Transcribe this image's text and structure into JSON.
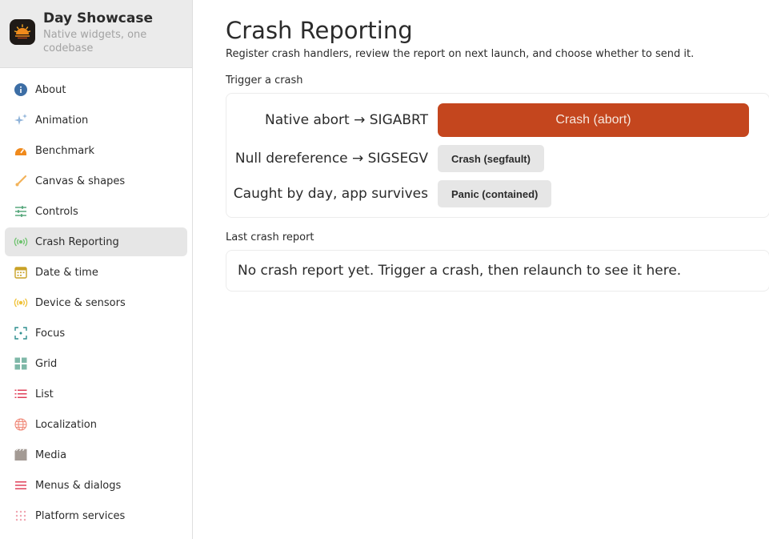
{
  "brand": {
    "title": "Day Showcase",
    "subtitle": "Native widgets, one codebase"
  },
  "sidebar": {
    "items": [
      {
        "label": "About",
        "icon": "info-icon"
      },
      {
        "label": "Animation",
        "icon": "sparkle-icon"
      },
      {
        "label": "Benchmark",
        "icon": "speedometer-icon"
      },
      {
        "label": "Canvas & shapes",
        "icon": "brush-icon"
      },
      {
        "label": "Controls",
        "icon": "sliders-icon"
      },
      {
        "label": "Crash Reporting",
        "icon": "broadcast-icon",
        "active": true
      },
      {
        "label": "Date & time",
        "icon": "calendar-icon"
      },
      {
        "label": "Device & sensors",
        "icon": "sensor-icon"
      },
      {
        "label": "Focus",
        "icon": "focus-icon"
      },
      {
        "label": "Grid",
        "icon": "grid-icon"
      },
      {
        "label": "List",
        "icon": "list-icon"
      },
      {
        "label": "Localization",
        "icon": "globe-icon"
      },
      {
        "label": "Media",
        "icon": "film-icon"
      },
      {
        "label": "Menus & dialogs",
        "icon": "menu-icon"
      },
      {
        "label": "Platform services",
        "icon": "dots-grid-icon"
      }
    ]
  },
  "main": {
    "title": "Crash Reporting",
    "description": "Register crash handlers, review the report on next launch, and choose whether to send it.",
    "trigger_section_label": "Trigger a crash",
    "triggers": [
      {
        "label": "Native abort → SIGABRT",
        "button": "Crash (abort)"
      },
      {
        "label": "Null dereference → SIGSEGV",
        "button": "Crash (segfault)"
      },
      {
        "label": "Caught by day, app survives",
        "button": "Panic (contained)"
      }
    ],
    "report_section_label": "Last crash report",
    "report_text": "No crash report yet. Trigger a crash, then relaunch to see it here."
  },
  "colors": {
    "accent": "#c4461e",
    "active_bg": "#e6e6e6"
  }
}
